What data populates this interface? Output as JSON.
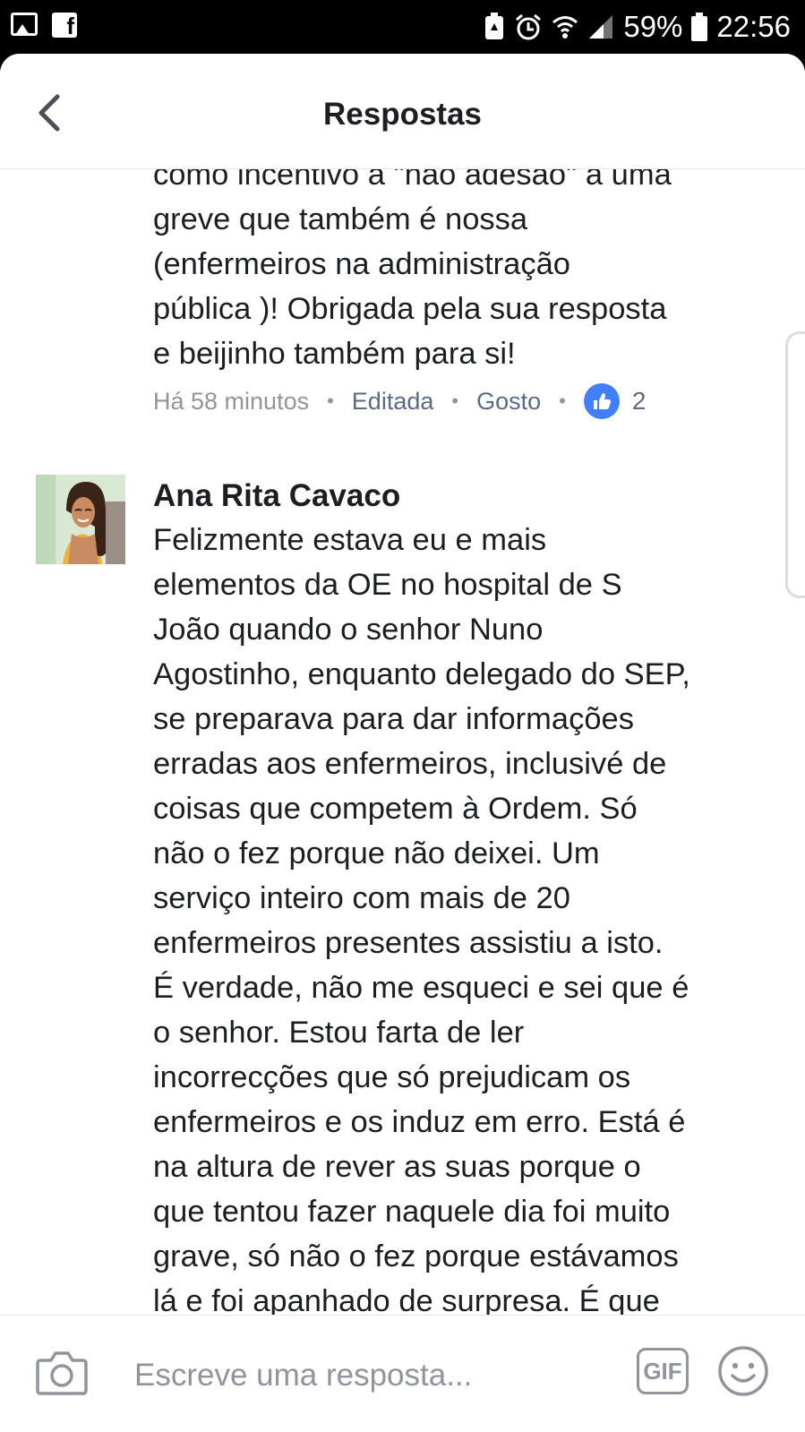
{
  "status_bar": {
    "battery": "59%",
    "time": "22:56",
    "icons": [
      "image-icon",
      "facebook-icon",
      "battery-saver-icon",
      "alarm-icon",
      "wifi-icon",
      "signal-icon",
      "battery-icon"
    ]
  },
  "header": {
    "title": "Respostas",
    "back_icon": "chevron-left-icon"
  },
  "comments": [
    {
      "text": "como incentivo à \"não adesão\" a uma\ngreve que também é  nossa\n(enfermeiros na administração\npública )! Obrigada pela sua resposta\ne beijinho também para si!",
      "timestamp": "Há 58 minutos",
      "edited_label": "Editada",
      "like_label": "Gosto",
      "reaction_count": "2"
    },
    {
      "author": "Ana Rita Cavaco",
      "text": "Felizmente estava eu e mais\nelementos da OE no hospital de S\nJoão quando o senhor Nuno\nAgostinho, enquanto delegado do SEP,\nse preparava para dar informações\nerradas aos enfermeiros, inclusivé de\ncoisas que competem à Ordem. Só\nnão o fez porque não deixei. Um\nserviço inteiro com mais de 20\nenfermeiros presentes assistiu a isto.\nÉ verdade, não me esqueci e sei que é\no senhor. Estou farta de ler\nincorrecções que só prejudicam os\nenfermeiros e os induz em erro. Está é\nna altura de rever as suas porque o\nque tentou fazer naquele dia foi muito\ngrave, só não o fez porque estávamos\nlá e foi apanhado de surpresa. É que"
    }
  ],
  "composer": {
    "placeholder": "Escreve uma resposta...",
    "gif_label": "GIF",
    "camera_icon": "camera-icon",
    "emoji_icon": "emoji-icon"
  },
  "colors": {
    "accent": "#4080ff",
    "link": "#5b6b86",
    "meta": "#90949c",
    "text": "#1c1e21"
  }
}
